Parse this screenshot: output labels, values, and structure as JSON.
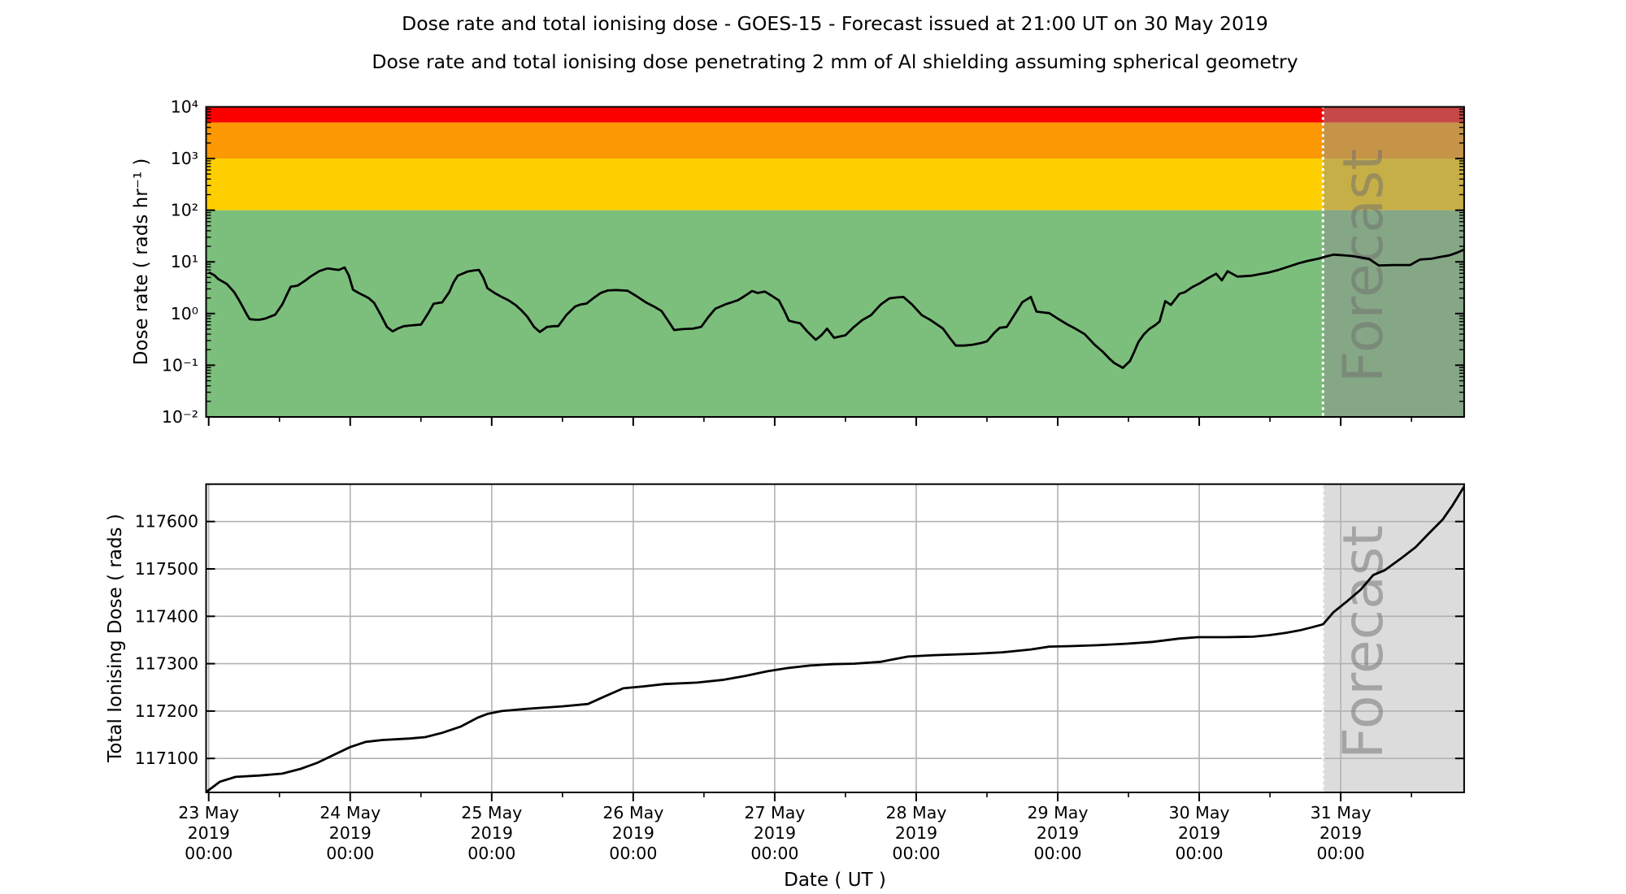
{
  "titles": {
    "main": "Dose rate and total ionising dose - GOES-15 - Forecast issued at 21:00 UT on 30 May 2019",
    "sub": "Dose rate and total ionising dose penetrating 2 mm of Al shielding assuming spherical geometry"
  },
  "forecast": {
    "label": "Forecast",
    "start_days_from_23may": 7.875
  },
  "xaxis": {
    "label": "Date ( UT )",
    "tick_days": [
      "23 May",
      "24 May",
      "25 May",
      "26 May",
      "27 May",
      "28 May",
      "29 May",
      "30 May",
      "31 May"
    ],
    "tick_year": "2019",
    "tick_time": "00:00"
  },
  "top_axis": {
    "label": "Dose rate ( rads hr⁻¹ )",
    "tick_labels": [
      "10⁴",
      "10³",
      "10²",
      "10¹",
      "10⁰",
      "10⁻¹",
      "10⁻²"
    ],
    "tick_exponents": [
      4,
      3,
      2,
      1,
      0,
      -1,
      -2
    ]
  },
  "bottom_axis": {
    "label": "Total Ionising Dose ( rads )",
    "ticks": [
      117100,
      117200,
      117300,
      117400,
      117500,
      117600
    ]
  },
  "colors": {
    "red": "#fc0000",
    "orange": "#fc9803",
    "yellow": "#fecf00",
    "green": "#7cbf7c",
    "forecast_overlay": "rgba(143,143,143,0.5)",
    "forecast_fill_bottom": "#dcdcdc",
    "grid": "#b2b2b2",
    "line": "#000000",
    "dotted_boundary": "#ffffff"
  },
  "chart_data": [
    {
      "type": "line",
      "panel": "dose_rate",
      "ylabel": "Dose rate ( rads hr⁻¹ )",
      "yscale": "log",
      "ylim": [
        0.01,
        10000
      ],
      "x_unit": "days since 23 May 2019 00:00 UT",
      "xlim": [
        -0.018,
        8.872
      ],
      "grid": false,
      "forecast_start": 7.875,
      "bands": [
        {
          "name": "green",
          "lo": 0.01,
          "hi": 100,
          "color": "#7cbf7c"
        },
        {
          "name": "yellow",
          "lo": 100,
          "hi": 1000,
          "color": "#fecf00"
        },
        {
          "name": "orange",
          "lo": 1000,
          "hi": 5000,
          "color": "#fc9803"
        },
        {
          "name": "red",
          "lo": 5000,
          "hi": 10000,
          "color": "#fc0000"
        }
      ],
      "series": [
        {
          "name": "dose_rate_rads_hr",
          "points": [
            [
              0.0,
              6.3
            ],
            [
              0.04,
              5.5
            ],
            [
              0.07,
              4.6
            ],
            [
              0.11,
              4.0
            ],
            [
              0.13,
              3.7
            ],
            [
              0.16,
              3.0
            ],
            [
              0.18,
              2.6
            ],
            [
              0.21,
              1.9
            ],
            [
              0.24,
              1.35
            ],
            [
              0.27,
              0.95
            ],
            [
              0.29,
              0.78
            ],
            [
              0.33,
              0.76
            ],
            [
              0.36,
              0.76
            ],
            [
              0.4,
              0.8
            ],
            [
              0.435,
              0.87
            ],
            [
              0.47,
              0.95
            ],
            [
              0.52,
              1.5
            ],
            [
              0.555,
              2.4
            ],
            [
              0.58,
              3.3
            ],
            [
              0.61,
              3.4
            ],
            [
              0.63,
              3.5
            ],
            [
              0.68,
              4.3
            ],
            [
              0.72,
              5.2
            ],
            [
              0.78,
              6.6
            ],
            [
              0.82,
              7.2
            ],
            [
              0.84,
              7.45
            ],
            [
              0.88,
              7.2
            ],
            [
              0.92,
              7.0
            ],
            [
              0.96,
              7.8
            ],
            [
              0.99,
              5.5
            ],
            [
              1.02,
              2.9
            ],
            [
              1.06,
              2.5
            ],
            [
              1.1,
              2.2
            ],
            [
              1.13,
              2.0
            ],
            [
              1.17,
              1.6
            ],
            [
              1.22,
              0.9
            ],
            [
              1.26,
              0.55
            ],
            [
              1.3,
              0.45
            ],
            [
              1.34,
              0.52
            ],
            [
              1.38,
              0.57
            ],
            [
              1.43,
              0.59
            ],
            [
              1.5,
              0.61
            ],
            [
              1.55,
              1.0
            ],
            [
              1.59,
              1.55
            ],
            [
              1.63,
              1.62
            ],
            [
              1.65,
              1.64
            ],
            [
              1.7,
              2.6
            ],
            [
              1.73,
              4.0
            ],
            [
              1.76,
              5.4
            ],
            [
              1.8,
              6.0
            ],
            [
              1.83,
              6.5
            ],
            [
              1.87,
              6.8
            ],
            [
              1.91,
              7.0
            ],
            [
              1.94,
              5.0
            ],
            [
              1.97,
              3.1
            ],
            [
              2.02,
              2.5
            ],
            [
              2.07,
              2.1
            ],
            [
              2.12,
              1.8
            ],
            [
              2.17,
              1.45
            ],
            [
              2.21,
              1.15
            ],
            [
              2.25,
              0.88
            ],
            [
              2.3,
              0.55
            ],
            [
              2.34,
              0.44
            ],
            [
              2.39,
              0.55
            ],
            [
              2.44,
              0.57
            ],
            [
              2.47,
              0.57
            ],
            [
              2.53,
              0.95
            ],
            [
              2.59,
              1.37
            ],
            [
              2.63,
              1.5
            ],
            [
              2.67,
              1.56
            ],
            [
              2.72,
              2.0
            ],
            [
              2.77,
              2.5
            ],
            [
              2.82,
              2.8
            ],
            [
              2.88,
              2.85
            ],
            [
              2.96,
              2.77
            ],
            [
              3.02,
              2.2
            ],
            [
              3.09,
              1.64
            ],
            [
              3.15,
              1.35
            ],
            [
              3.2,
              1.12
            ],
            [
              3.25,
              0.7
            ],
            [
              3.29,
              0.48
            ],
            [
              3.35,
              0.5
            ],
            [
              3.42,
              0.51
            ],
            [
              3.48,
              0.55
            ],
            [
              3.53,
              0.85
            ],
            [
              3.58,
              1.24
            ],
            [
              3.65,
              1.5
            ],
            [
              3.74,
              1.81
            ],
            [
              3.79,
              2.2
            ],
            [
              3.84,
              2.73
            ],
            [
              3.88,
              2.5
            ],
            [
              3.93,
              2.67
            ],
            [
              3.98,
              2.2
            ],
            [
              4.03,
              1.79
            ],
            [
              4.07,
              1.1
            ],
            [
              4.1,
              0.73
            ],
            [
              4.14,
              0.68
            ],
            [
              4.18,
              0.65
            ],
            [
              4.23,
              0.45
            ],
            [
              4.29,
              0.31
            ],
            [
              4.33,
              0.38
            ],
            [
              4.37,
              0.51
            ],
            [
              4.42,
              0.34
            ],
            [
              4.46,
              0.36
            ],
            [
              4.5,
              0.38
            ],
            [
              4.56,
              0.55
            ],
            [
              4.62,
              0.75
            ],
            [
              4.68,
              0.93
            ],
            [
              4.75,
              1.5
            ],
            [
              4.81,
              1.97
            ],
            [
              4.86,
              2.05
            ],
            [
              4.91,
              2.09
            ],
            [
              4.97,
              1.5
            ],
            [
              5.04,
              0.93
            ],
            [
              5.1,
              0.75
            ],
            [
              5.19,
              0.51
            ],
            [
              5.24,
              0.33
            ],
            [
              5.28,
              0.24
            ],
            [
              5.34,
              0.24
            ],
            [
              5.4,
              0.25
            ],
            [
              5.46,
              0.27
            ],
            [
              5.5,
              0.29
            ],
            [
              5.55,
              0.42
            ],
            [
              5.59,
              0.53
            ],
            [
              5.64,
              0.55
            ],
            [
              5.7,
              1.0
            ],
            [
              5.75,
              1.66
            ],
            [
              5.81,
              2.09
            ],
            [
              5.85,
              1.09
            ],
            [
              5.9,
              1.05
            ],
            [
              5.94,
              1.02
            ],
            [
              6.0,
              0.8
            ],
            [
              6.07,
              0.61
            ],
            [
              6.13,
              0.5
            ],
            [
              6.19,
              0.4
            ],
            [
              6.26,
              0.25
            ],
            [
              6.32,
              0.18
            ],
            [
              6.37,
              0.13
            ],
            [
              6.4,
              0.11
            ],
            [
              6.46,
              0.089
            ],
            [
              6.51,
              0.12
            ],
            [
              6.54,
              0.18
            ],
            [
              6.57,
              0.28
            ],
            [
              6.61,
              0.4
            ],
            [
              6.65,
              0.51
            ],
            [
              6.69,
              0.6
            ],
            [
              6.72,
              0.7
            ],
            [
              6.76,
              1.74
            ],
            [
              6.8,
              1.47
            ],
            [
              6.86,
              2.4
            ],
            [
              6.9,
              2.6
            ],
            [
              6.95,
              3.23
            ],
            [
              7.0,
              3.8
            ],
            [
              7.06,
              4.8
            ],
            [
              7.12,
              5.9
            ],
            [
              7.16,
              4.4
            ],
            [
              7.2,
              6.6
            ],
            [
              7.27,
              5.2
            ],
            [
              7.32,
              5.3
            ],
            [
              7.37,
              5.4
            ],
            [
              7.43,
              5.8
            ],
            [
              7.49,
              6.2
            ],
            [
              7.56,
              7.0
            ],
            [
              7.62,
              7.9
            ],
            [
              7.71,
              9.5
            ],
            [
              7.77,
              10.5
            ],
            [
              7.84,
              11.5
            ],
            [
              7.9,
              12.8
            ],
            [
              7.95,
              13.8
            ],
            [
              8.02,
              13.4
            ],
            [
              8.08,
              13.0
            ],
            [
              8.14,
              12.2
            ],
            [
              8.2,
              11.4
            ],
            [
              8.27,
              8.5
            ],
            [
              8.32,
              8.6
            ],
            [
              8.37,
              8.7
            ],
            [
              8.43,
              8.7
            ],
            [
              8.49,
              8.7
            ],
            [
              8.56,
              11.1
            ],
            [
              8.64,
              11.5
            ],
            [
              8.7,
              12.4
            ],
            [
              8.77,
              13.4
            ],
            [
              8.82,
              15.0
            ],
            [
              8.872,
              17.3
            ]
          ]
        }
      ]
    },
    {
      "type": "line",
      "panel": "total_ionising_dose",
      "ylabel": "Total Ionising Dose ( rads )",
      "yscale": "linear",
      "ylim": [
        117028,
        117679
      ],
      "x_unit": "days since 23 May 2019 00:00 UT",
      "xlim": [
        -0.018,
        8.872
      ],
      "grid": true,
      "forecast_start": 7.875,
      "series": [
        {
          "name": "total_dose_rads",
          "points": [
            [
              -0.018,
              117029
            ],
            [
              0.08,
              117051
            ],
            [
              0.19,
              117061
            ],
            [
              0.36,
              117064
            ],
            [
              0.52,
              117068
            ],
            [
              0.65,
              117078
            ],
            [
              0.77,
              117091
            ],
            [
              0.88,
              117107
            ],
            [
              1.0,
              117124
            ],
            [
              1.11,
              117135
            ],
            [
              1.23,
              117139
            ],
            [
              1.42,
              117142
            ],
            [
              1.53,
              117145
            ],
            [
              1.65,
              117154
            ],
            [
              1.78,
              117167
            ],
            [
              1.9,
              117186
            ],
            [
              1.97,
              117194
            ],
            [
              2.07,
              117200
            ],
            [
              2.26,
              117205
            ],
            [
              2.5,
              117210
            ],
            [
              2.68,
              117215
            ],
            [
              2.8,
              117231
            ],
            [
              2.93,
              117248
            ],
            [
              3.07,
              117252
            ],
            [
              3.22,
              117257
            ],
            [
              3.45,
              117260
            ],
            [
              3.64,
              117266
            ],
            [
              3.79,
              117274
            ],
            [
              3.95,
              117284
            ],
            [
              4.1,
              117291
            ],
            [
              4.25,
              117296
            ],
            [
              4.41,
              117299
            ],
            [
              4.56,
              117300
            ],
            [
              4.75,
              117304
            ],
            [
              4.94,
              117315
            ],
            [
              5.13,
              117318
            ],
            [
              5.42,
              117321
            ],
            [
              5.61,
              117324
            ],
            [
              5.81,
              117330
            ],
            [
              5.94,
              117336
            ],
            [
              6.09,
              117337
            ],
            [
              6.28,
              117339
            ],
            [
              6.48,
              117342
            ],
            [
              6.67,
              117346
            ],
            [
              6.86,
              117353
            ],
            [
              6.99,
              117356
            ],
            [
              7.18,
              117356
            ],
            [
              7.38,
              117357
            ],
            [
              7.49,
              117360
            ],
            [
              7.61,
              117365
            ],
            [
              7.72,
              117371
            ],
            [
              7.8,
              117377
            ],
            [
              7.875,
              117383
            ],
            [
              7.95,
              117409
            ],
            [
              8.05,
              117433
            ],
            [
              8.14,
              117456
            ],
            [
              8.23,
              117487
            ],
            [
              8.31,
              117497
            ],
            [
              8.43,
              117523
            ],
            [
              8.53,
              117546
            ],
            [
              8.62,
              117574
            ],
            [
              8.72,
              117604
            ],
            [
              8.79,
              117634
            ],
            [
              8.872,
              117674
            ]
          ]
        }
      ]
    }
  ]
}
